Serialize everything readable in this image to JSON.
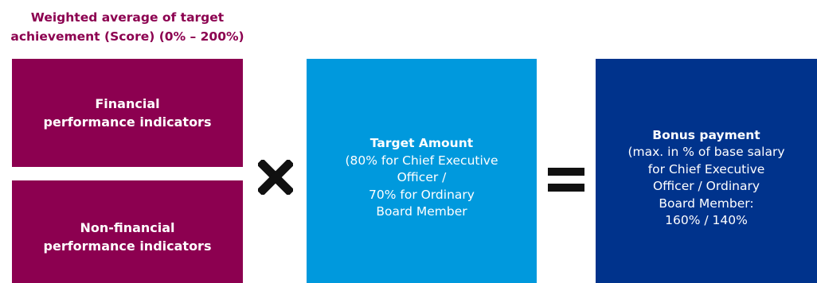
{
  "heading": {
    "line1": "Weighted average of target",
    "line2": "achievement (Score) (0% – 200%)"
  },
  "boxes": {
    "financial": {
      "line1": "Financial",
      "line2": "performance indicators",
      "color": "#8c0050"
    },
    "non_financial": {
      "line1": "Non-financial",
      "line2": "performance indicators",
      "color": "#8c0050"
    },
    "target_amount": {
      "title": "Target Amount",
      "lines": [
        "(80% for Chief Executive",
        "Officer /",
        "70% for Ordinary",
        "Board Member"
      ],
      "color": "#0099dd"
    },
    "bonus_payment": {
      "title": "Bonus payment",
      "lines": [
        "(max. in % of base salary",
        "for Chief Executive",
        "Officer / Ordinary",
        "Board Member:",
        "160% / 140%"
      ],
      "color": "#00338c"
    }
  },
  "operators": {
    "multiply": "multiply-icon",
    "equals": "equals-icon"
  }
}
